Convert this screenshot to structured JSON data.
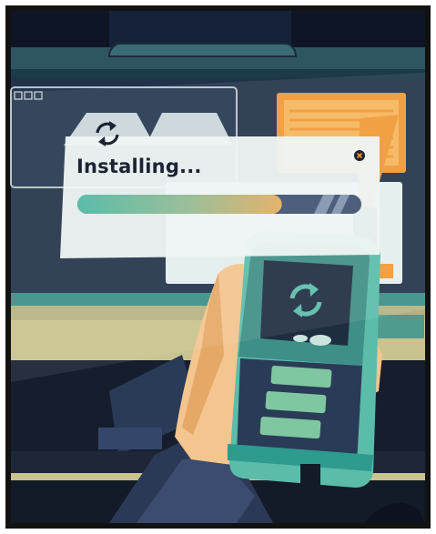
{
  "dialog": {
    "title": "Installing...",
    "progress_fraction": 0.72
  },
  "icons": {
    "dialog_icon": "refresh-icon",
    "device_icon": "refresh-icon",
    "close_icon": "close-icon"
  },
  "colors": {
    "background": "#1e2a3e",
    "frame": "#121212",
    "accent_teal": "#5bbcaa",
    "accent_orange": "#f09a34",
    "dialog_bg": "#eef5f4",
    "title_text": "#1c2333"
  }
}
